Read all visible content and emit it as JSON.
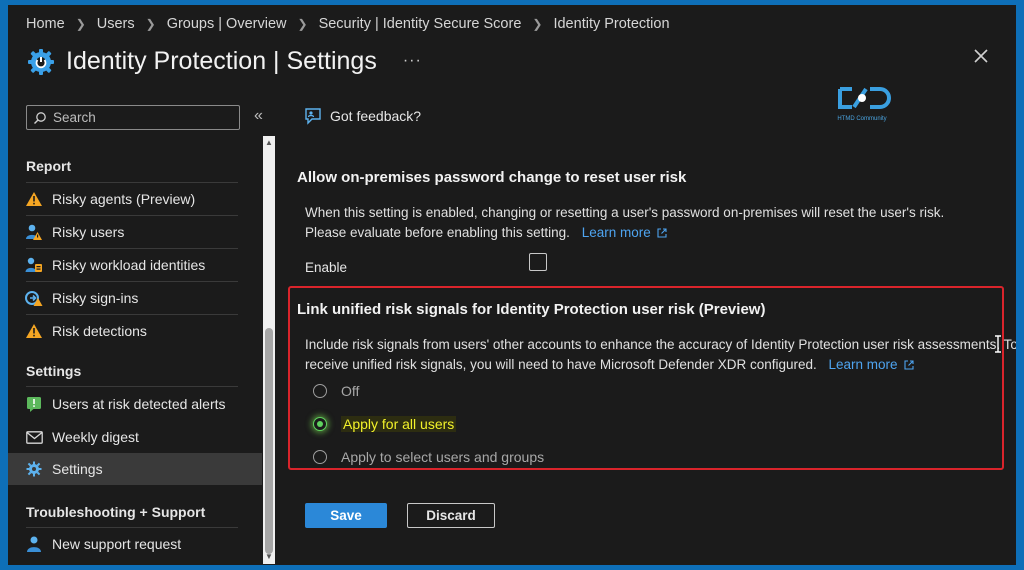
{
  "breadcrumb": [
    "Home",
    "Users",
    "Groups | Overview",
    "Security | Identity Secure Score",
    "Identity Protection"
  ],
  "title": "Identity Protection | Settings",
  "title_more": "···",
  "search": {
    "placeholder": "Search"
  },
  "collapse_glyph": "«",
  "sidebar": {
    "sections": [
      {
        "label": "Report",
        "items": [
          {
            "label": "Risky agents (Preview)",
            "icon": "warning-icon"
          },
          {
            "label": "Risky users",
            "icon": "user-risk-icon"
          },
          {
            "label": "Risky workload identities",
            "icon": "workload-identity-icon"
          },
          {
            "label": "Risky sign-ins",
            "icon": "sign-in-icon"
          },
          {
            "label": "Risk detections",
            "icon": "warning-icon"
          }
        ]
      },
      {
        "label": "Settings",
        "items": [
          {
            "label": "Users at risk detected alerts",
            "icon": "alert-icon"
          },
          {
            "label": "Weekly digest",
            "icon": "mail-icon"
          },
          {
            "label": "Settings",
            "icon": "gear-icon",
            "active": true
          }
        ]
      },
      {
        "label": "Troubleshooting + Support",
        "items": [
          {
            "label": "New support request",
            "icon": "support-person-icon"
          }
        ]
      }
    ]
  },
  "feedback": {
    "label": "Got feedback?"
  },
  "logo": {
    "caption": "HTMD Community"
  },
  "section1": {
    "title": "Allow on-premises password change to reset user risk",
    "desc_line1": "When this setting is enabled, changing or resetting a user's password on-premises will reset the user's risk.",
    "desc_line2": "Please evaluate before enabling this setting.",
    "link": "Learn more",
    "enable_label": "Enable",
    "enable_checked": false
  },
  "section2": {
    "title": "Link unified risk signals for Identity Protection user risk (Preview)",
    "desc_line1": "Include risk signals from users' other accounts to enhance the accuracy of Identity Protection user risk assessments. To",
    "desc_line2": "receive unified risk signals, you will need to have Microsoft Defender XDR configured.",
    "link": "Learn more",
    "options": [
      {
        "label": "Off",
        "checked": false
      },
      {
        "label": "Apply for all users",
        "checked": true
      },
      {
        "label": "Apply to select users and groups",
        "checked": false
      }
    ]
  },
  "buttons": {
    "save": "Save",
    "discard": "Discard"
  },
  "colors": {
    "accent": "#2b88d8",
    "link": "#4ea4f0",
    "highlight_box": "#d9242b",
    "selected_radio": "#5fd35f"
  }
}
